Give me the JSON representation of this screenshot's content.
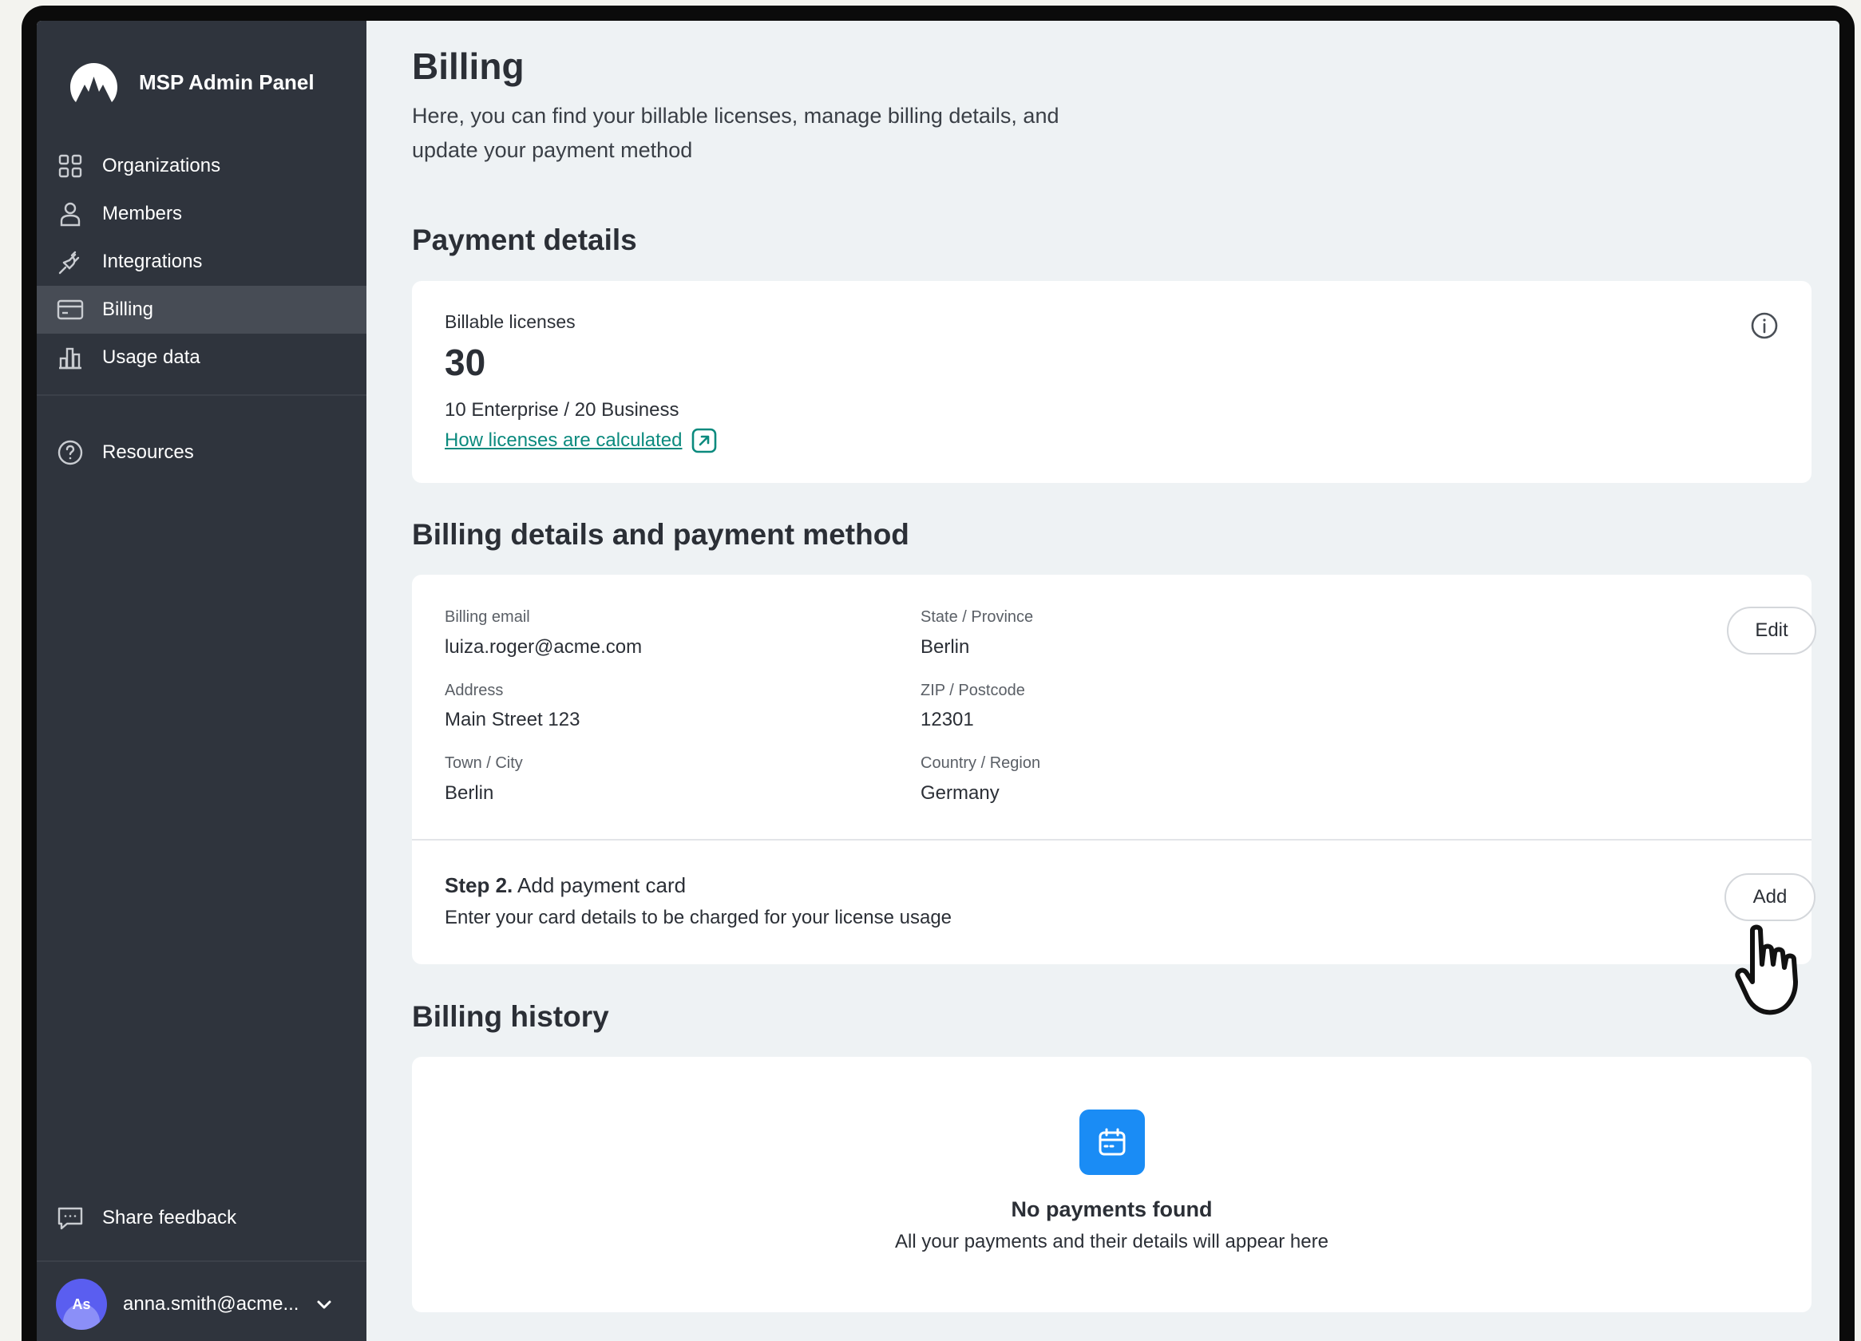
{
  "app": {
    "title": "MSP Admin Panel"
  },
  "sidebar": {
    "items": [
      {
        "label": "Organizations",
        "icon": "grid-icon"
      },
      {
        "label": "Members",
        "icon": "user-icon"
      },
      {
        "label": "Integrations",
        "icon": "plug-icon"
      },
      {
        "label": "Billing",
        "icon": "credit-card-icon",
        "active": true
      },
      {
        "label": "Usage data",
        "icon": "bar-chart-icon"
      }
    ],
    "resources": {
      "label": "Resources",
      "icon": "help-circle-icon"
    },
    "feedback": {
      "label": "Share feedback",
      "icon": "chat-icon"
    },
    "account": {
      "initials": "As",
      "email": "anna.smith@acme..."
    }
  },
  "page": {
    "title": "Billing",
    "description": "Here, you can find your billable licenses, manage billing details, and update your payment method"
  },
  "payment_details": {
    "heading": "Payment details",
    "licenses_label": "Billable licenses",
    "licenses_count": "30",
    "licenses_breakdown": "10 Enterprise / 20 Business",
    "licenses_link": "How licenses are calculated"
  },
  "billing_details": {
    "heading": "Billing details and payment method",
    "edit_label": "Edit",
    "fields": {
      "email": {
        "label": "Billing email",
        "value": "luiza.roger@acme.com"
      },
      "address": {
        "label": "Address",
        "value": "Main Street 123"
      },
      "city": {
        "label": "Town / City",
        "value": "Berlin"
      },
      "state": {
        "label": "State / Province",
        "value": "Berlin"
      },
      "zip": {
        "label": "ZIP / Postcode",
        "value": "12301"
      },
      "country": {
        "label": "Country / Region",
        "value": "Germany"
      }
    },
    "step": {
      "prefix": "Step 2.",
      "title": "Add payment card",
      "description": "Enter your card details to be charged for your license usage",
      "add_label": "Add"
    }
  },
  "billing_history": {
    "heading": "Billing history",
    "empty_title": "No payments found",
    "empty_description": "All your payments and their details will appear here"
  },
  "colors": {
    "sidebar_bg": "#2f343d",
    "sidebar_active": "#474c55",
    "link": "#0b8a7e",
    "accent_blue": "#1a8cf5",
    "page_bg": "#eef2f4"
  }
}
